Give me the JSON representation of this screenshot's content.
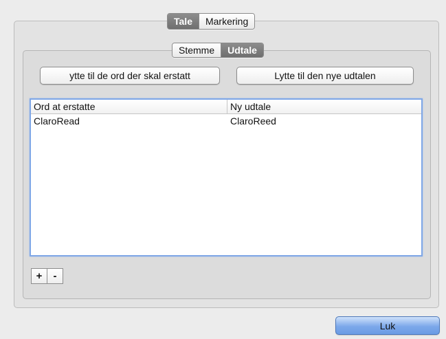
{
  "top_tabs": [
    {
      "label": "Tale",
      "selected": true
    },
    {
      "label": "Markering",
      "selected": false
    }
  ],
  "sub_tabs": [
    {
      "label": "Stemme",
      "selected": false
    },
    {
      "label": "Udtale",
      "selected": true
    }
  ],
  "buttons": {
    "listen_old": "ytte til de ord der skal erstatt",
    "listen_new": "Lytte til den nye udtalen",
    "add": "+",
    "remove": "-",
    "close": "Luk"
  },
  "table": {
    "columns": [
      "Ord at erstatte",
      "Ny udtale"
    ],
    "rows": [
      [
        "ClaroRead",
        "ClaroReed"
      ]
    ]
  },
  "colors": {
    "focus_ring": "#7fa7e6",
    "default_button": "#7ca8ea",
    "selected_tab": "#7d7d7d"
  }
}
